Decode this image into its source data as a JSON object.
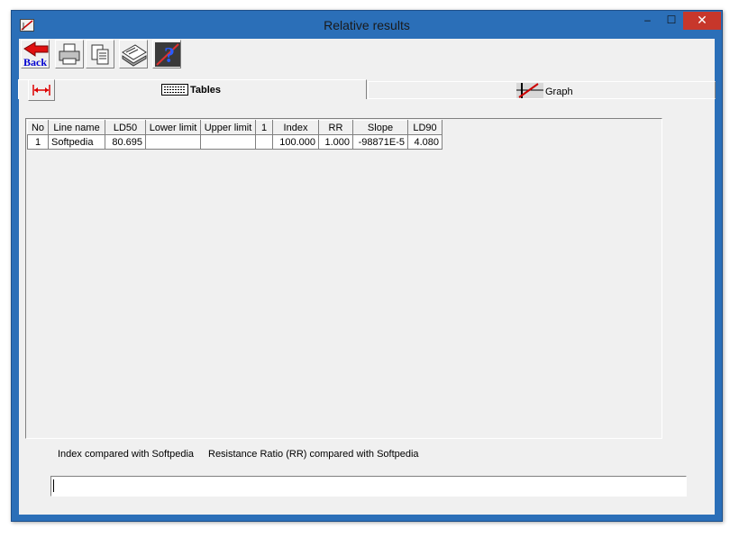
{
  "window": {
    "title": "Relative results",
    "minimize": "–",
    "maximize": "☐",
    "close": "✕"
  },
  "toolbar": {
    "back_label": "Back"
  },
  "tabs": [
    {
      "label": "Tables"
    },
    {
      "label": "Graph"
    }
  ],
  "table": {
    "headers": [
      "No",
      "Line name",
      "LD50",
      "Lower limit",
      "Upper limit",
      "1",
      "Index",
      "RR",
      "Slope",
      "LD90"
    ],
    "rows": [
      [
        "1",
        "Softpedia",
        "80.695",
        "",
        "",
        "",
        "100.000",
        "1.000",
        "-98871E-5",
        "4.080"
      ]
    ]
  },
  "info": {
    "index_text": "Index compared with Softpedia",
    "rr_text": "Resistance Ratio (RR) compared with Softpedia"
  },
  "status": {
    "value": ""
  }
}
